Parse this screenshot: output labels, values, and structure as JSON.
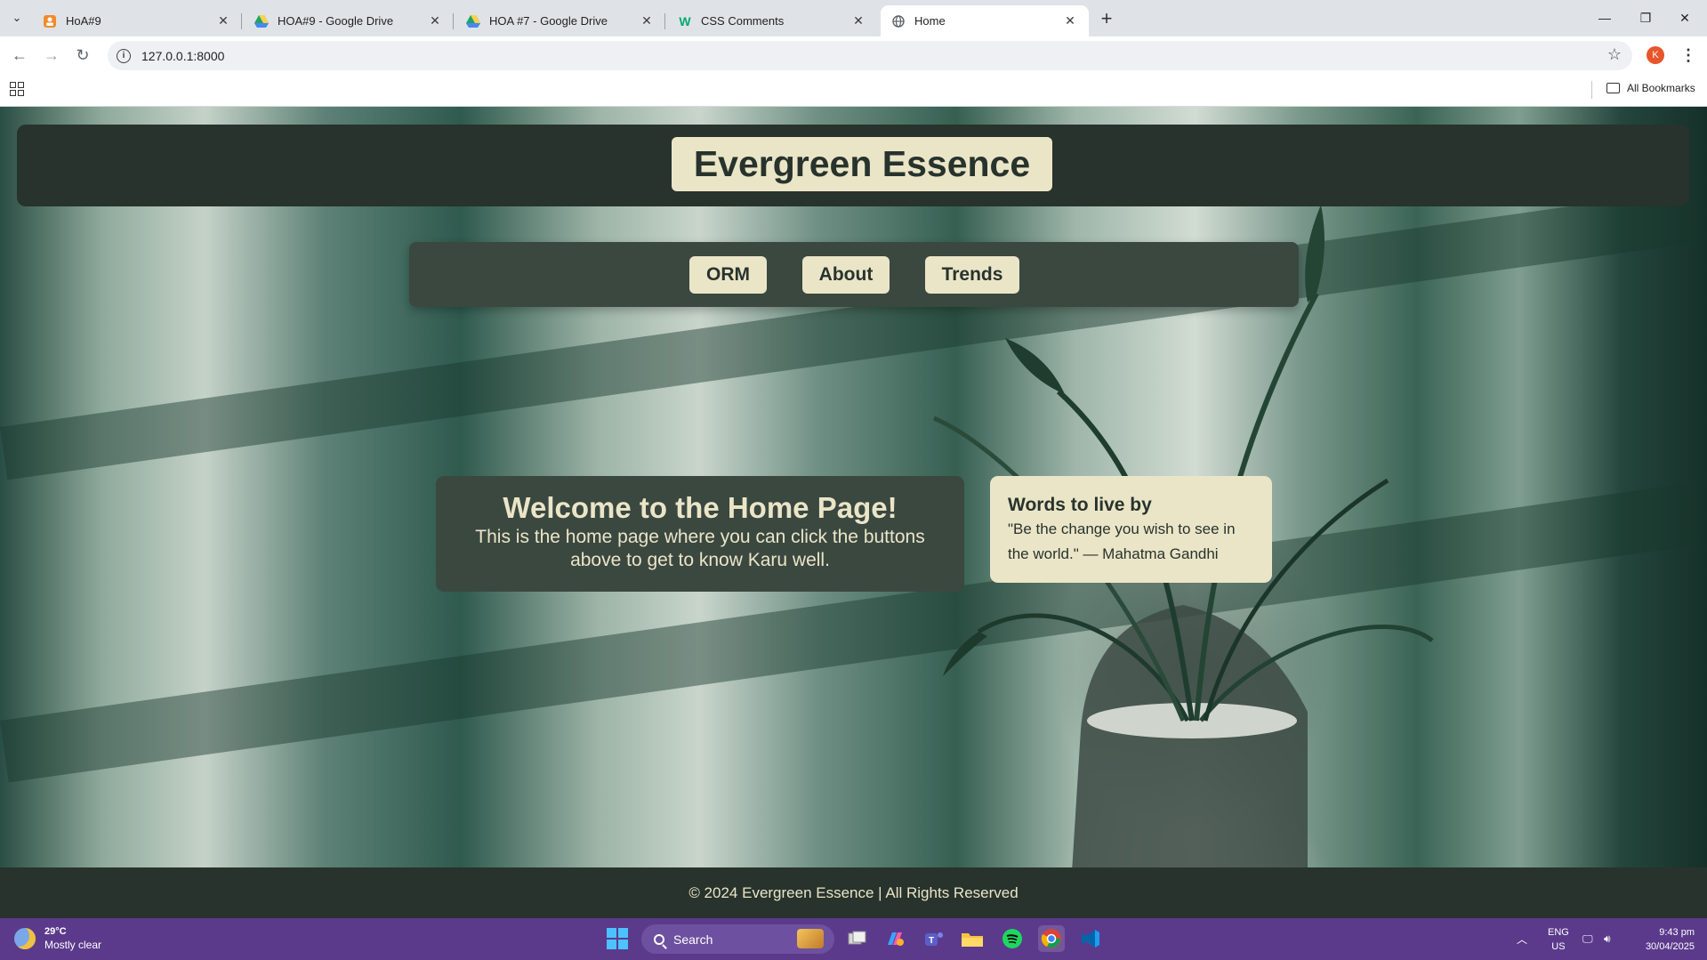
{
  "browser": {
    "tabs": [
      {
        "title": "HoA#9",
        "icon": "app-orange-icon"
      },
      {
        "title": "HOA#9 - Google Drive",
        "icon": "google-drive-icon"
      },
      {
        "title": "HOA #7 - Google Drive",
        "icon": "google-drive-icon"
      },
      {
        "title": "CSS Comments",
        "icon": "w3schools-icon"
      },
      {
        "title": "Home",
        "icon": "globe-icon",
        "active": true
      }
    ],
    "url": "127.0.0.1:8000",
    "profile_initial": "K",
    "bookmarks_label": "All Bookmarks"
  },
  "page": {
    "brand": "Evergreen Essence",
    "nav": [
      "ORM",
      "About",
      "Trends"
    ],
    "welcome": {
      "title": "Welcome to the Home Page!",
      "text": "This is the home page where you can click the buttons above to get to know Karu well."
    },
    "quote": {
      "heading": "Words to live by",
      "text": "\"Be the change you wish to see in the world.\" — Mahatma Gandhi"
    },
    "footer": "© 2024 Evergreen Essence | All Rights Reserved"
  },
  "taskbar": {
    "weather": {
      "temp": "29°C",
      "condition": "Mostly clear"
    },
    "search_placeholder": "Search",
    "lang": {
      "line1": "ENG",
      "line2": "US"
    },
    "time": "9:43 pm",
    "date": "30/04/2025"
  },
  "colors": {
    "header_bg": "#27332c",
    "nav_bg": "#3a4840",
    "cream": "#ebe5c8",
    "taskbar": "#5b3a8c"
  }
}
